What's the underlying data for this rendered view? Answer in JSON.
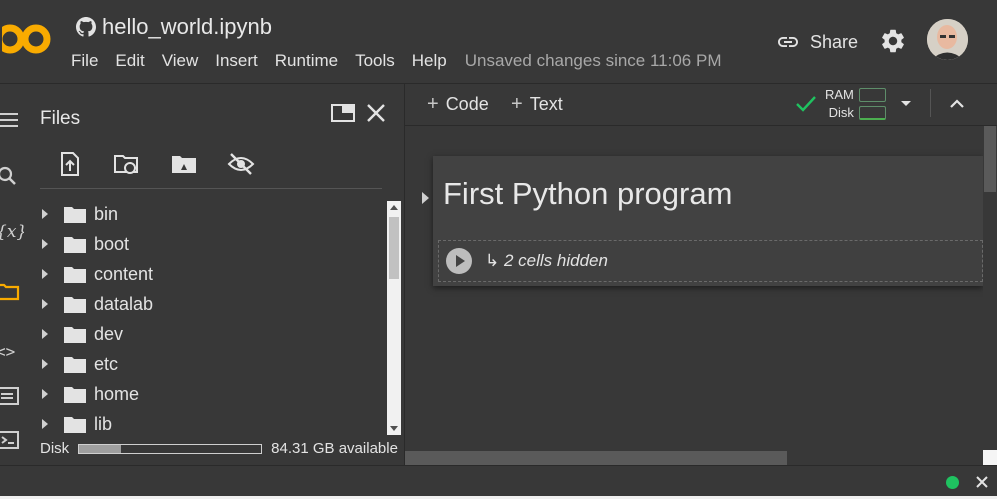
{
  "notebook": {
    "title": "hello_world.ipynb"
  },
  "menu": {
    "items": [
      "File",
      "Edit",
      "View",
      "Insert",
      "Runtime",
      "Tools",
      "Help"
    ],
    "status": "Unsaved changes since 11:06 PM"
  },
  "header": {
    "share_label": "Share"
  },
  "files_panel": {
    "title": "Files",
    "folders": [
      "bin",
      "boot",
      "content",
      "datalab",
      "dev",
      "etc",
      "home",
      "lib"
    ],
    "disk_label": "Disk",
    "disk_available": "84.31 GB available",
    "disk_used_fraction": 0.23
  },
  "toolbar": {
    "code_label": "Code",
    "text_label": "Text",
    "ram_label": "RAM",
    "disk_label": "Disk"
  },
  "cell": {
    "heading": "First Python program",
    "hidden_text": "↳ 2 cells hidden"
  },
  "colors": {
    "accent_orange": "#f9ab00",
    "connected_green": "#1fc260",
    "background": "#383838"
  }
}
